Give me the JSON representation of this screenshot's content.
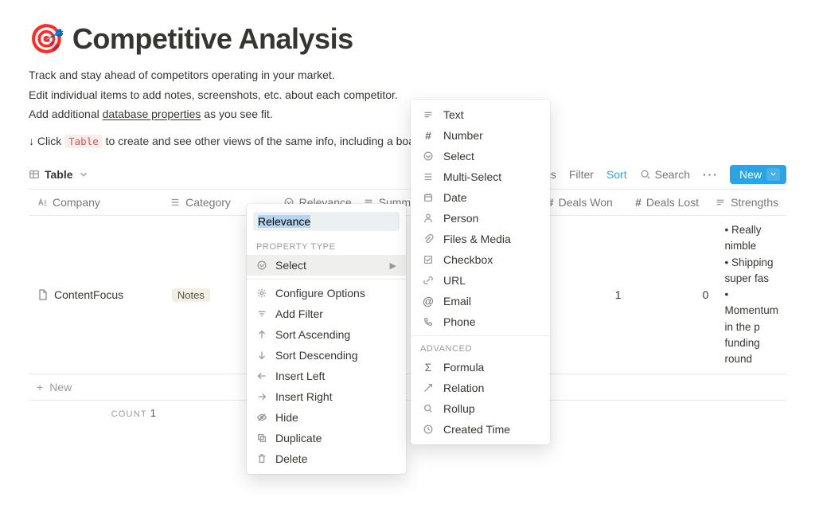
{
  "header": {
    "icon": "🎯",
    "title": "Competitive Analysis"
  },
  "description": {
    "line1": "Track and stay ahead of competitors operating in your market.",
    "line2": "Edit individual items to add notes, screenshots, etc. about each competitor.",
    "line3_before": "Add additional ",
    "line3_link": "database properties",
    "line3_after": " as you see fit."
  },
  "hint": {
    "prefix": "↓ Click ",
    "tag": "Table",
    "suffix": " to create and see other views of the same info, including a board organize"
  },
  "toolbar": {
    "view_label": "Table",
    "properties": "erties",
    "filter": "Filter",
    "sort": "Sort",
    "search": "Search",
    "more": "···",
    "new": "New"
  },
  "columns": {
    "company": "Company",
    "category": "Category",
    "relevance": "Relevance",
    "summary": "Summ",
    "deals_won": "Deals Won",
    "deals_lost": "Deals Lost",
    "strengths": "Strengths"
  },
  "rows": [
    {
      "company": "ContentFocus",
      "category_tag": "Notes",
      "deals_won": "1",
      "deals_lost": "0",
      "strengths": "• Really nimble\n• Shipping super fas\n• Momentum in the p\nfunding round"
    }
  ],
  "newrow_label": "New",
  "count_label": "COUNT",
  "count_value": "1",
  "column_menu": {
    "input_value": "Relevance",
    "section_type": "PROPERTY TYPE",
    "type_row": "Select",
    "configure": "Configure Options",
    "add_filter": "Add Filter",
    "sort_asc": "Sort Ascending",
    "sort_desc": "Sort Descending",
    "insert_left": "Insert Left",
    "insert_right": "Insert Right",
    "hide": "Hide",
    "duplicate": "Duplicate",
    "delete": "Delete"
  },
  "type_menu": {
    "text": "Text",
    "number": "Number",
    "select": "Select",
    "multi_select": "Multi-Select",
    "date": "Date",
    "person": "Person",
    "files": "Files & Media",
    "checkbox": "Checkbox",
    "url": "URL",
    "email": "Email",
    "phone": "Phone",
    "advanced": "ADVANCED",
    "formula": "Formula",
    "relation": "Relation",
    "rollup": "Rollup",
    "created": "Created Time"
  }
}
